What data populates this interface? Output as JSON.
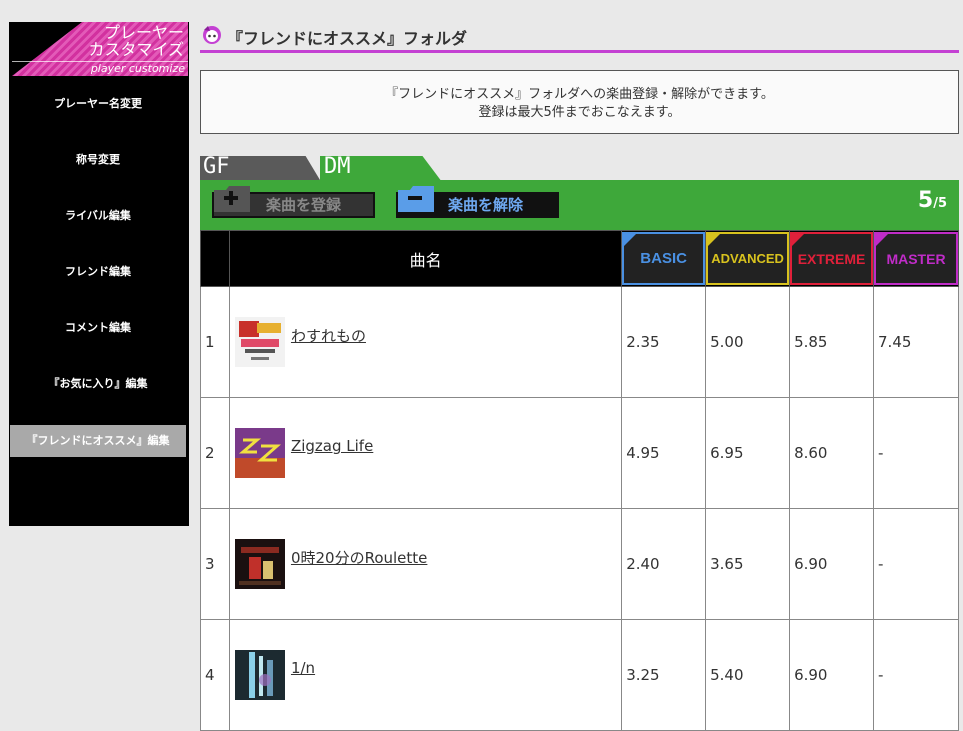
{
  "sidebar": {
    "header": {
      "line1": "プレーヤー",
      "line2": "カスタマイズ",
      "sub": "player customize"
    },
    "items": [
      {
        "label": "プレーヤー名変更"
      },
      {
        "label": "称号変更"
      },
      {
        "label": "ライバル編集"
      },
      {
        "label": "フレンド編集"
      },
      {
        "label": "コメント編集"
      },
      {
        "label": "『お気に入り』編集"
      },
      {
        "label": "『フレンドにオススメ』編集",
        "active": true
      }
    ]
  },
  "page": {
    "title": "『フレンドにオススメ』フォルダ",
    "info_line1": "『フレンドにオススメ』フォルダへの楽曲登録・解除ができます。",
    "info_line2": "登録は最大5件までおこなえます。"
  },
  "tabs": [
    {
      "label": "GF"
    },
    {
      "label": "DM",
      "active": true
    }
  ],
  "toolbar": {
    "add_label": "楽曲を登録",
    "remove_label": "楽曲を解除",
    "count": "5",
    "count_max": "/5"
  },
  "table": {
    "col_title": "曲名",
    "difficulties": [
      {
        "label": "BASIC",
        "color": "#4a90e2"
      },
      {
        "label": "ADVANCED",
        "color": "#d8c21e"
      },
      {
        "label": "EXTREME",
        "color": "#e0203a"
      },
      {
        "label": "MASTER",
        "color": "#c02cc8"
      }
    ],
    "rows": [
      {
        "no": "1",
        "title": "わすれもの",
        "levels": [
          "2.35",
          "5.00",
          "5.85",
          "7.45"
        ]
      },
      {
        "no": "2",
        "title": "Zigzag Life",
        "levels": [
          "4.95",
          "6.95",
          "8.60",
          "-"
        ]
      },
      {
        "no": "3",
        "title": "0時20分のRoulette",
        "levels": [
          "2.40",
          "3.65",
          "6.90",
          "-"
        ]
      },
      {
        "no": "4",
        "title": "1/n",
        "levels": [
          "3.25",
          "5.40",
          "6.90",
          "-"
        ]
      }
    ]
  }
}
